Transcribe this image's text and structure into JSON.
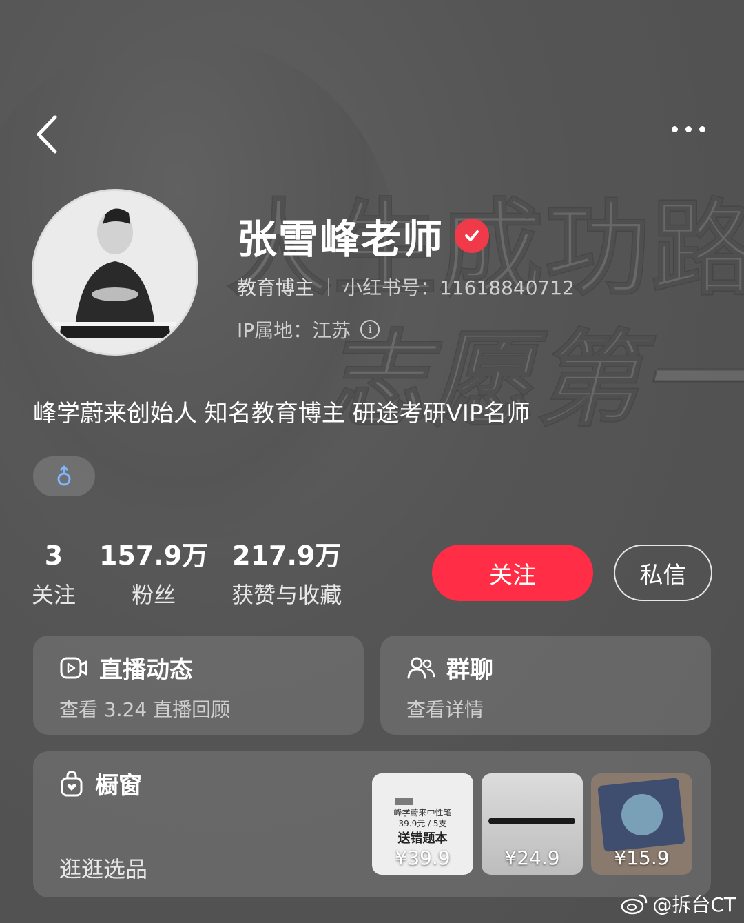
{
  "background": {
    "line1": "人生成功路",
    "line2": "志愿第一步"
  },
  "profile": {
    "name": "张雪峰老师",
    "category": "教育博主",
    "redbook_id": "小红书号：11618840712",
    "ip_location": "IP属地：江苏",
    "bio": "峰学蔚来创始人 知名教育博主 研途考研VIP名师",
    "gender_symbol": "♂"
  },
  "stats": [
    {
      "num": "3",
      "label": "关注"
    },
    {
      "num": "157.9万",
      "label": "粉丝"
    },
    {
      "num": "217.9万",
      "label": "获赞与收藏"
    }
  ],
  "actions": {
    "follow": "关注",
    "message": "私信"
  },
  "cards": {
    "live": {
      "title": "直播动态",
      "sub": "查看 3.24 直播回顾"
    },
    "group": {
      "title": "群聊",
      "sub": "查看详情"
    },
    "shop": {
      "title": "橱窗",
      "sub": "逛逛选品"
    }
  },
  "products": [
    {
      "price": "¥39.9",
      "line1": "峰学蔚来中性笔",
      "line2": "39.9元 / 5支",
      "line3": "送错题本"
    },
    {
      "price": "¥24.9"
    },
    {
      "price": "¥15.9"
    }
  ],
  "watermark": "@拆台CT",
  "colors": {
    "accent": "#ff2d46",
    "verified": "#f03a4a",
    "gender": "#7fb6ff"
  }
}
